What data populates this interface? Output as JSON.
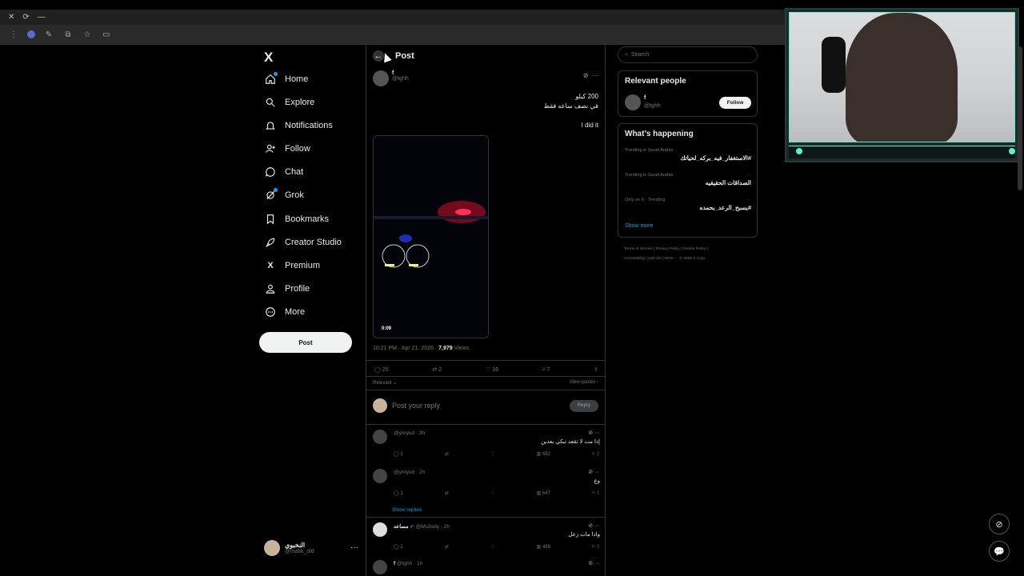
{
  "browser": {
    "tab_icons": [
      "close-icon",
      "reload-icon",
      "minimize-icon"
    ]
  },
  "nav": {
    "logo": "X",
    "items": [
      {
        "label": "Home",
        "icon": "home-icon"
      },
      {
        "label": "Explore",
        "icon": "search-icon"
      },
      {
        "label": "Notifications",
        "icon": "bell-icon"
      },
      {
        "label": "Follow",
        "icon": "follow-icon"
      },
      {
        "label": "Chat",
        "icon": "chat-icon"
      },
      {
        "label": "Grok",
        "icon": "grok-icon"
      },
      {
        "label": "Bookmarks",
        "icon": "bookmark-icon"
      },
      {
        "label": "Creator Studio",
        "icon": "rocket-icon"
      },
      {
        "label": "Premium",
        "icon": "x-icon"
      },
      {
        "label": "Profile",
        "icon": "person-icon"
      },
      {
        "label": "More",
        "icon": "more-circle-icon"
      }
    ],
    "post_button": "Post",
    "account": {
      "name": "النخبوي",
      "handle": "@malik_old",
      "more": "···"
    }
  },
  "post": {
    "header_title": "Post",
    "author_name": "f",
    "author_handle": "@tghh",
    "text_line1": "200 كيلو",
    "text_line2": "في نصف ساعه فقط",
    "text_line3": "I did it",
    "video_duration": "0:09",
    "time": "10:21 PM · Apr 21, 2026 · ",
    "views_count": "7,979",
    "views_label": " Views",
    "replies": "25",
    "reposts": "2",
    "likes": "16",
    "bookmarks": "7",
    "sort_label": "Relevant",
    "view_quotes": "View quotes",
    "reply_placeholder": "Post your reply",
    "reply_button": "Reply"
  },
  "comments": [
    {
      "handle": "@ynryud · 2h",
      "text": "إذا مت لا تقعد تبكي بعدين",
      "replies": "1",
      "views": "652"
    },
    {
      "handle": "@ynryud · 2h",
      "text": "وع",
      "replies": "1",
      "views": "647"
    },
    {
      "name": "مساعد",
      "handle": "@Ms3ody · 2h",
      "text": "واذا مات زعل",
      "replies": "2",
      "views": "456"
    },
    {
      "name": "f",
      "handle": "@tghh · 1h"
    }
  ],
  "show_replies": "Show replies",
  "right": {
    "search_placeholder": "Search",
    "relevant_title": "Relevant people",
    "relevant_name": "f",
    "relevant_handle": "@tghh",
    "follow_button": "Follow",
    "happening_title": "What’s happening",
    "trends": [
      {
        "context": "Trending in Saudi Arabia",
        "tag": "#الاستغفار_فيه_بركه_لحياتك"
      },
      {
        "context": "Trending in Saudi Arabia",
        "tag": "الصداقات الحقيقيه"
      },
      {
        "context": "Only on X · Trending",
        "tag": "#يسبح_الرعد_بحمده"
      }
    ],
    "show_more": "Show more",
    "footer_line1": "Terms of Service  |  Privacy Policy  |  Cookie Policy  |",
    "footer_line2": "Accessibility  |  Ads info  |  More ···  © 2026 X Corp."
  },
  "colors": {
    "accent": "#1d9bf0",
    "border": "#2f3336",
    "cam_accent": "#5ef0c8"
  }
}
